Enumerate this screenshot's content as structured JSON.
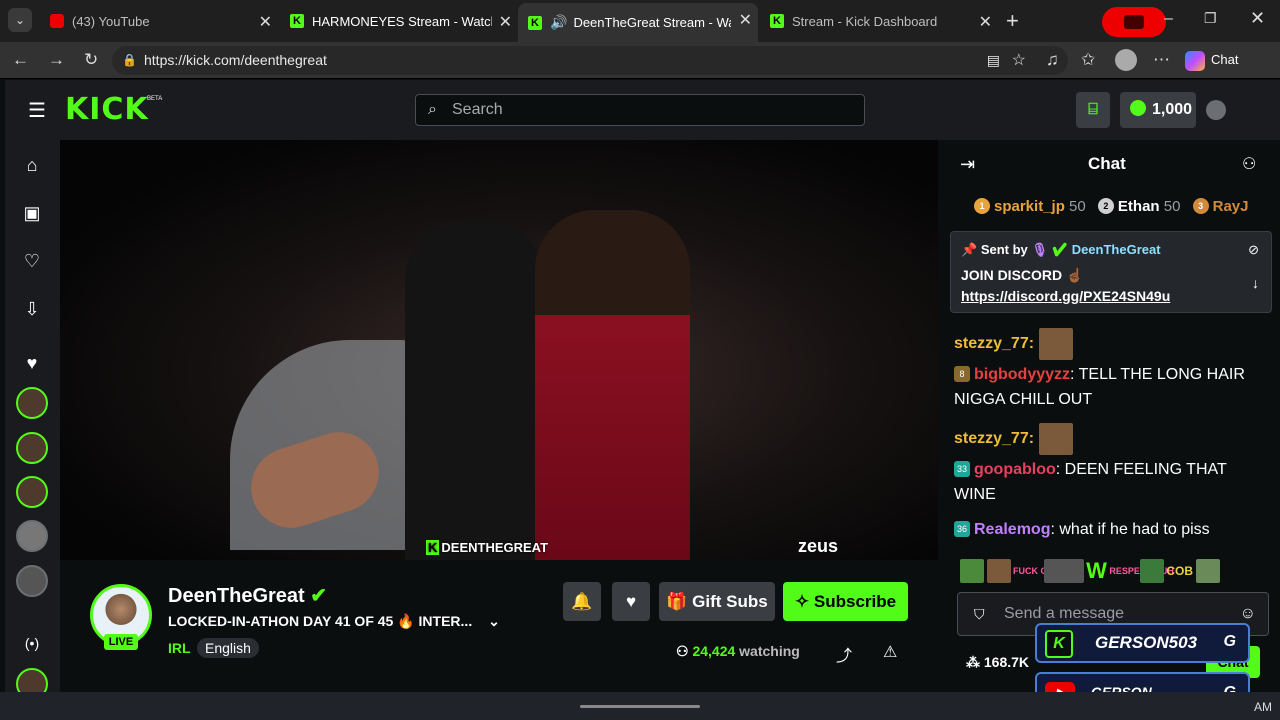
{
  "browser": {
    "tabs": [
      {
        "title": "(43) YouTube"
      },
      {
        "title": "HARMONEYES Stream - Watch Live"
      },
      {
        "title": "DeenTheGreat Stream - Watch"
      },
      {
        "title": "Stream - Kick Dashboard"
      }
    ],
    "url": "https://kick.com/deenthegreat",
    "chat_button": "Chat"
  },
  "site": {
    "logo": "KICK",
    "beta": "BETA",
    "search_placeholder": "Search",
    "points": "1,000"
  },
  "video": {
    "watermark": "DEENTHEGREAT",
    "sponsor": "zeus"
  },
  "channel": {
    "name": "DeenTheGreat",
    "live_badge": "LIVE",
    "title": "LOCKED-IN-ATHON DAY 41 OF 45 🔥 INTER...",
    "category": "IRL",
    "language": "English",
    "viewers": "24,424",
    "viewers_suffix": "watching",
    "gift_subs": "Gift Subs",
    "subscribe": "Subscribe"
  },
  "chat": {
    "header": "Chat",
    "leaderboard": [
      {
        "rank": "1",
        "name": "sparkit_jp",
        "score": "50",
        "color": "#e8a33d"
      },
      {
        "rank": "2",
        "name": "Ethan",
        "score": "50",
        "color": "#cfcfcf"
      },
      {
        "rank": "3",
        "name": "RayJ",
        "score": "",
        "color": "#d18a3c"
      }
    ],
    "pinned": {
      "sent_by": "Sent by",
      "author": "DeenTheGreat",
      "text": "JOIN DISCORD ☝🏾",
      "link": "https://discord.gg/PXE24SN49u"
    },
    "messages": [
      {
        "user": "stezzy_77",
        "text": "",
        "color": "#f0bd3a",
        "badge": ""
      },
      {
        "user": "bigbodyyyzz",
        "text": "TELL THE LONG HAIR NIGGA CHILL OUT",
        "color": "#e84040",
        "badge": "8"
      },
      {
        "user": "stezzy_77",
        "text": "",
        "color": "#f0bd3a",
        "badge": ""
      },
      {
        "user": "goopabloo",
        "text": "DEEN FEELING THAT WINE",
        "color": "#e84060",
        "badge": "33"
      },
      {
        "user": "Realemog",
        "text": "what if he had to piss",
        "color": "#c080ff",
        "badge": "36"
      }
    ],
    "emotes": [
      "FUCK CUH",
      "W",
      "RESPECT CUH",
      "COB"
    ],
    "send_placeholder": "Send a message",
    "points": "168.7K",
    "chat_button": "Chat"
  },
  "overlay": {
    "kick_name": "GERSON503",
    "youtube_name": "GERSON QUINTANILLA"
  },
  "taskbar": {
    "time": "AM"
  }
}
